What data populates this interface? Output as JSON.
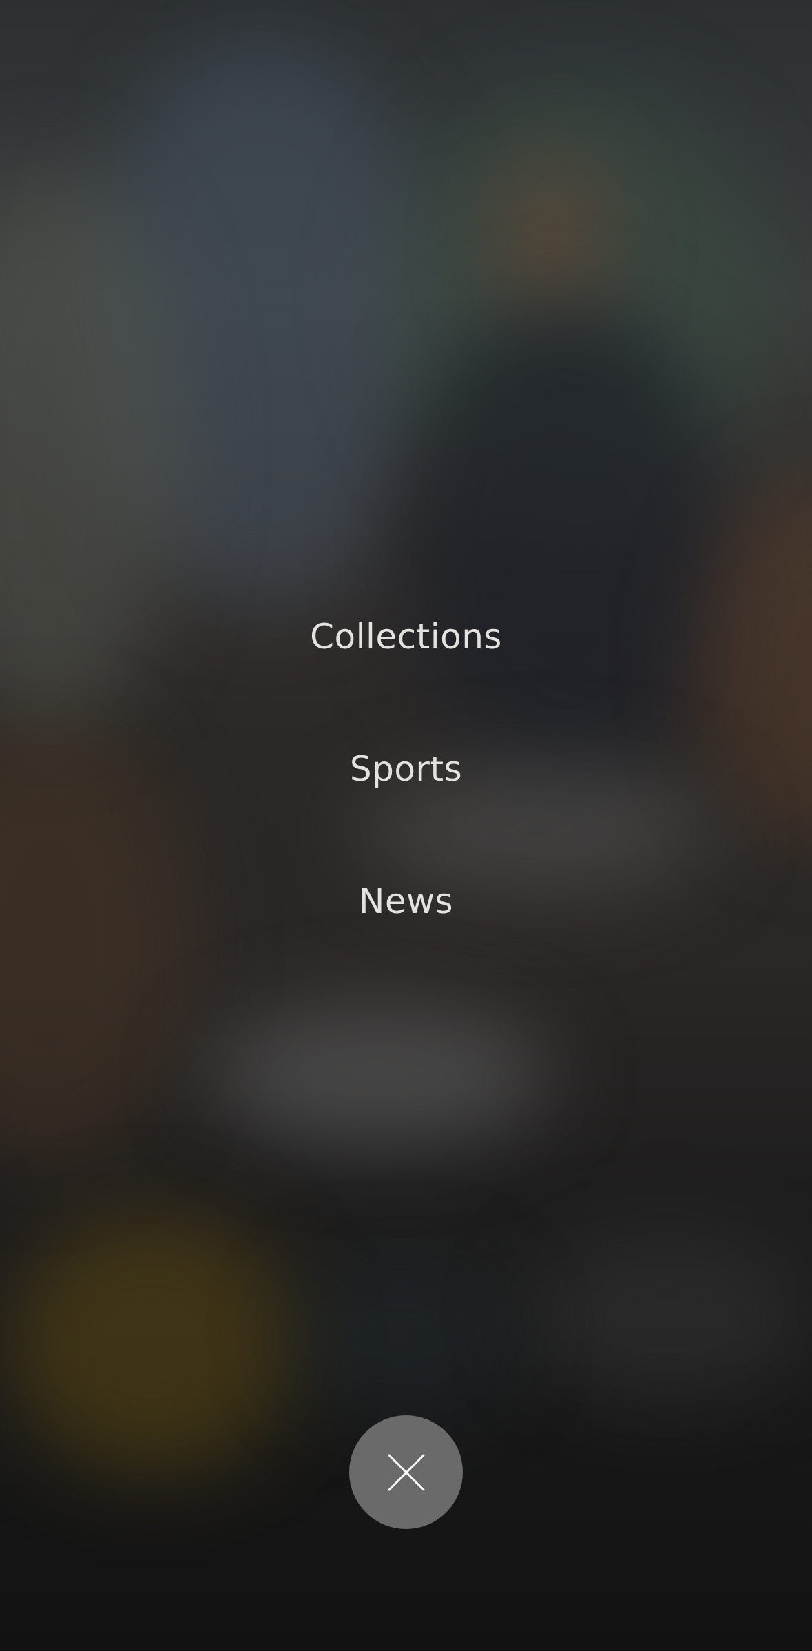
{
  "menu": {
    "items": [
      {
        "label": "Collections"
      },
      {
        "label": "Sports"
      },
      {
        "label": "News"
      }
    ]
  },
  "close_button": {
    "icon": "close-icon",
    "background": "#6a6a6a",
    "icon_color": "#ffffff"
  },
  "colors": {
    "text": "#e4e2de",
    "overlay_background": "#141414"
  }
}
